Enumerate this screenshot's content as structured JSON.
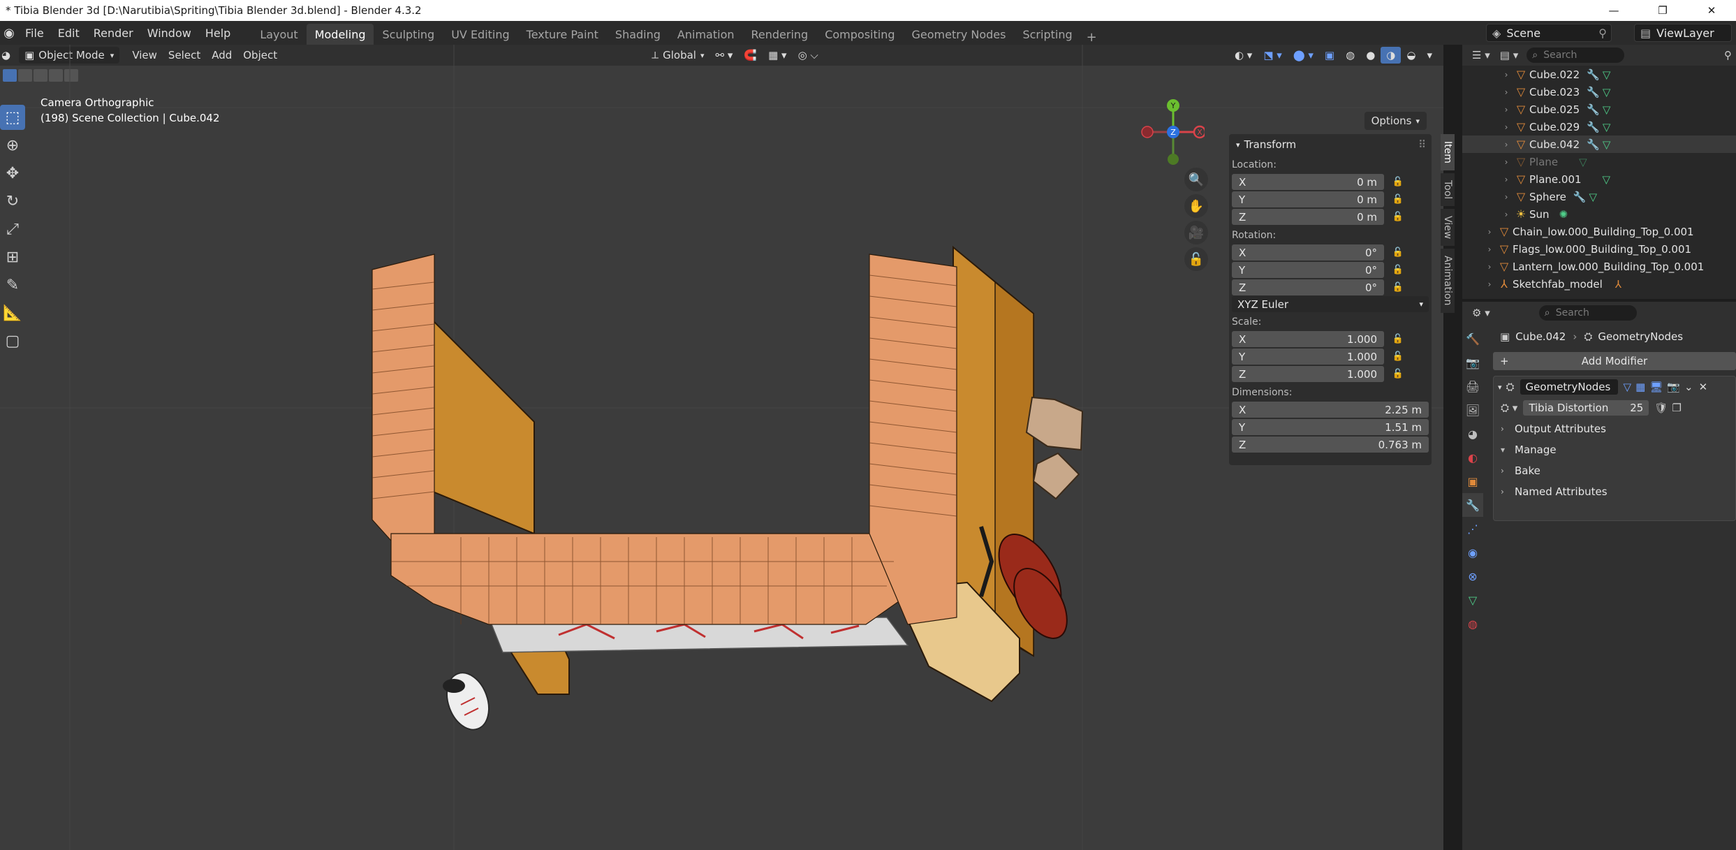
{
  "window": {
    "title": "* Tibia Blender 3d [D:\\Narutibia\\Spriting\\Tibia Blender 3d.blend] - Blender 4.3.2",
    "minimize": "—",
    "maximize": "❐",
    "close": "✕"
  },
  "menu": [
    "File",
    "Edit",
    "Render",
    "Window",
    "Help"
  ],
  "workspaces": [
    "Layout",
    "Modeling",
    "Sculpting",
    "UV Editing",
    "Texture Paint",
    "Shading",
    "Animation",
    "Rendering",
    "Compositing",
    "Geometry Nodes",
    "Scripting"
  ],
  "active_workspace": "Modeling",
  "scene": {
    "label": "Scene",
    "view_layer": "ViewLayer"
  },
  "viewport": {
    "mode": "Object Mode",
    "menus": [
      "View",
      "Select",
      "Add",
      "Object"
    ],
    "transform_orientation": "Global",
    "options": "Options",
    "info_line1": "Camera Orthographic",
    "info_line2": "(198) Scene Collection | Cube.042",
    "gizmo": {
      "x": "X",
      "y": "Y",
      "z": "Z"
    }
  },
  "npanel": {
    "title": "Transform",
    "location_label": "Location:",
    "location": {
      "x": "0 m",
      "y": "0 m",
      "z": "0 m"
    },
    "rotation_label": "Rotation:",
    "rotation": {
      "x": "0°",
      "y": "0°",
      "z": "0°"
    },
    "rotation_mode": "XYZ Euler",
    "scale_label": "Scale:",
    "scale": {
      "x": "1.000",
      "y": "1.000",
      "z": "1.000"
    },
    "dimensions_label": "Dimensions:",
    "dimensions": {
      "x": "2.25 m",
      "y": "1.51 m",
      "z": "0.763 m"
    },
    "axis": {
      "x": "X",
      "y": "Y",
      "z": "Z"
    },
    "tabs": [
      "Item",
      "Tool",
      "View",
      "Animation"
    ]
  },
  "outliner": {
    "search_placeholder": "Search",
    "items": [
      {
        "name": "Cube.022"
      },
      {
        "name": "Cube.023"
      },
      {
        "name": "Cube.025"
      },
      {
        "name": "Cube.029"
      },
      {
        "name": "Cube.042"
      },
      {
        "name": "Plane"
      },
      {
        "name": "Plane.001"
      },
      {
        "name": "Sphere"
      },
      {
        "name": "Sun"
      },
      {
        "name": "Chain_low.000_Building_Top_0.001"
      },
      {
        "name": "Flags_low.000_Building_Top_0.001"
      },
      {
        "name": "Lantern_low.000_Building_Top_0.001"
      },
      {
        "name": "Sketchfab_model"
      }
    ]
  },
  "properties": {
    "search_placeholder": "Search",
    "object": "Cube.042",
    "modifier_type": "GeometryNodes",
    "add_modifier": "Add Modifier",
    "modifier_name": "GeometryNodes",
    "node_group": "Tibia Distortion",
    "node_group_users": "25",
    "subpanels": [
      "Output Attributes",
      "Manage",
      "Bake",
      "Named Attributes"
    ]
  },
  "colors": {
    "accent": "#4772b3",
    "viewport_bg": "#3c3c3c",
    "brick": "#e49a6a",
    "wood": "#c98a2e",
    "barrel": "#9a2a1a"
  }
}
